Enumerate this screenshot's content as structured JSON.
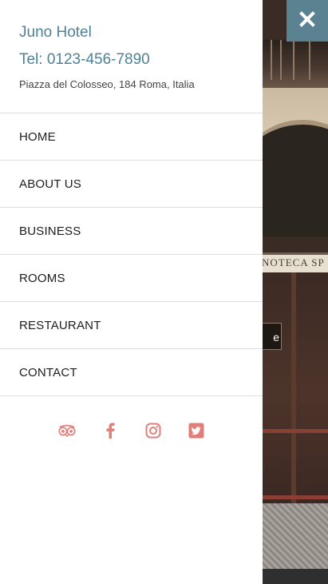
{
  "menu": {
    "hotel_name": "Juno Hotel",
    "phone": "Tel: 0123-456-7890",
    "address": "Piazza del Colosseo, 184 Roma, Italia",
    "items": [
      {
        "label": "HOME"
      },
      {
        "label": "ABOUT US"
      },
      {
        "label": "BUSINESS"
      },
      {
        "label": "ROOMS"
      },
      {
        "label": "RESTAURANT"
      },
      {
        "label": "CONTACT"
      }
    ],
    "social": [
      {
        "icon": "tripadvisor-icon"
      },
      {
        "icon": "facebook-icon"
      },
      {
        "icon": "instagram-icon"
      },
      {
        "icon": "twitter-icon"
      }
    ]
  },
  "close_button": {
    "icon": "close-icon"
  },
  "background": {
    "sign_text": "NOTECA SP",
    "peek_label": "e"
  },
  "colors": {
    "accent": "#4f8296",
    "close_bg": "#5a8290",
    "social": "#e07f7a",
    "divider": "#dddddd"
  }
}
